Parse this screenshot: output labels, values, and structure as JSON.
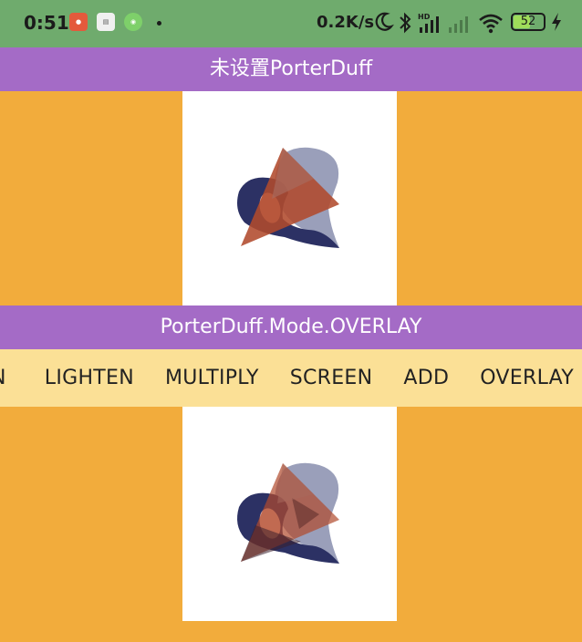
{
  "status_bar": {
    "time": "0:51",
    "network_speed": "0.2K/s",
    "battery_level": "52",
    "notification_icons": [
      "app-notification-icon",
      "app-notification-icon",
      "android-icon"
    ],
    "status_icons": [
      "do-not-disturb-moon-icon",
      "bluetooth-icon",
      "hd-signal-icon",
      "signal-icon",
      "wifi-icon",
      "battery-icon",
      "charging-bolt-icon"
    ]
  },
  "header": {
    "title": "未设置PorterDuff"
  },
  "mode_header": {
    "title": "PorterDuff.Mode.OVERLAY"
  },
  "modes": {
    "items": [
      {
        "label": "N"
      },
      {
        "label": "LIGHTEN"
      },
      {
        "label": "MULTIPLY"
      },
      {
        "label": "SCREEN"
      },
      {
        "label": "ADD"
      },
      {
        "label": "OVERLAY"
      }
    ],
    "selected": "OVERLAY"
  },
  "colors": {
    "status_bar": "#6fab6d",
    "title_bar": "#a46bc6",
    "background": "#f2ac3c",
    "mode_strip": "#fbe096",
    "blob_dark": "#2c3164",
    "blob_light": "#9a9fba",
    "triangle": "#b04a2c"
  }
}
